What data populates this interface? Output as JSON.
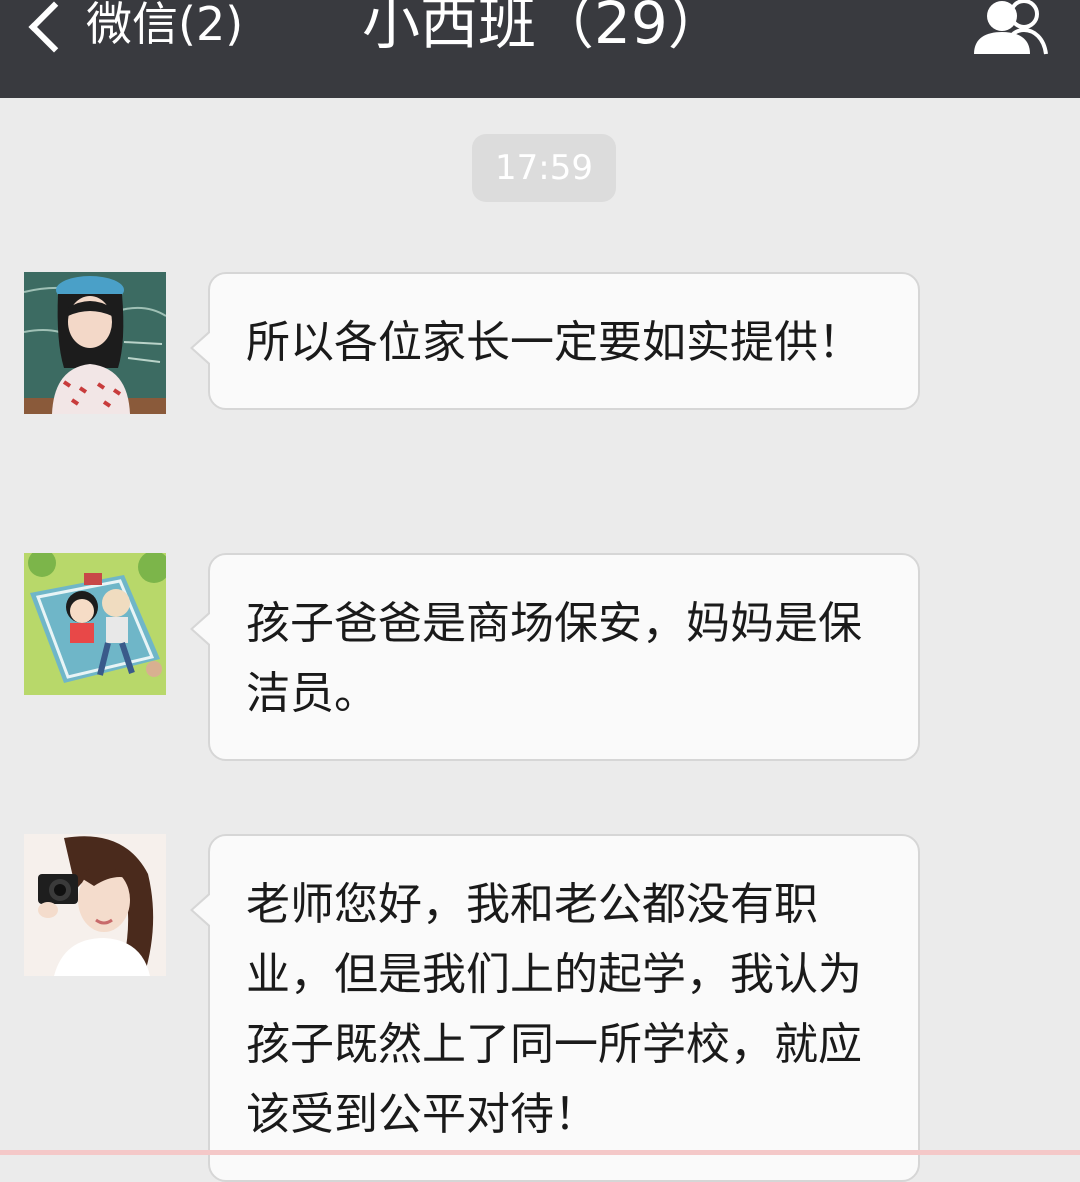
{
  "header": {
    "back_label": "微信(2)",
    "title": "小西班（29）",
    "members_icon": "person-group-icon"
  },
  "timestamp": "17:59",
  "messages": [
    {
      "avatar_icon": "avatar-girl-chalkboard",
      "text": "所以各位家长一定要如实提供！"
    },
    {
      "avatar_icon": "avatar-cartoon-picnic",
      "text": "孩子爸爸是商场保安，妈妈是保洁员。"
    },
    {
      "avatar_icon": "avatar-girl-camera",
      "text": "老师您好，我和老公都没有职业，但是我们上的起学，我认为孩子既然上了同一所学校，就应该受到公平对待！"
    }
  ],
  "colors": {
    "topbar": "#393a3f",
    "background": "#ebebeb",
    "bubble": "#fafafa",
    "timestamp_bg": "#dcdcdc"
  }
}
